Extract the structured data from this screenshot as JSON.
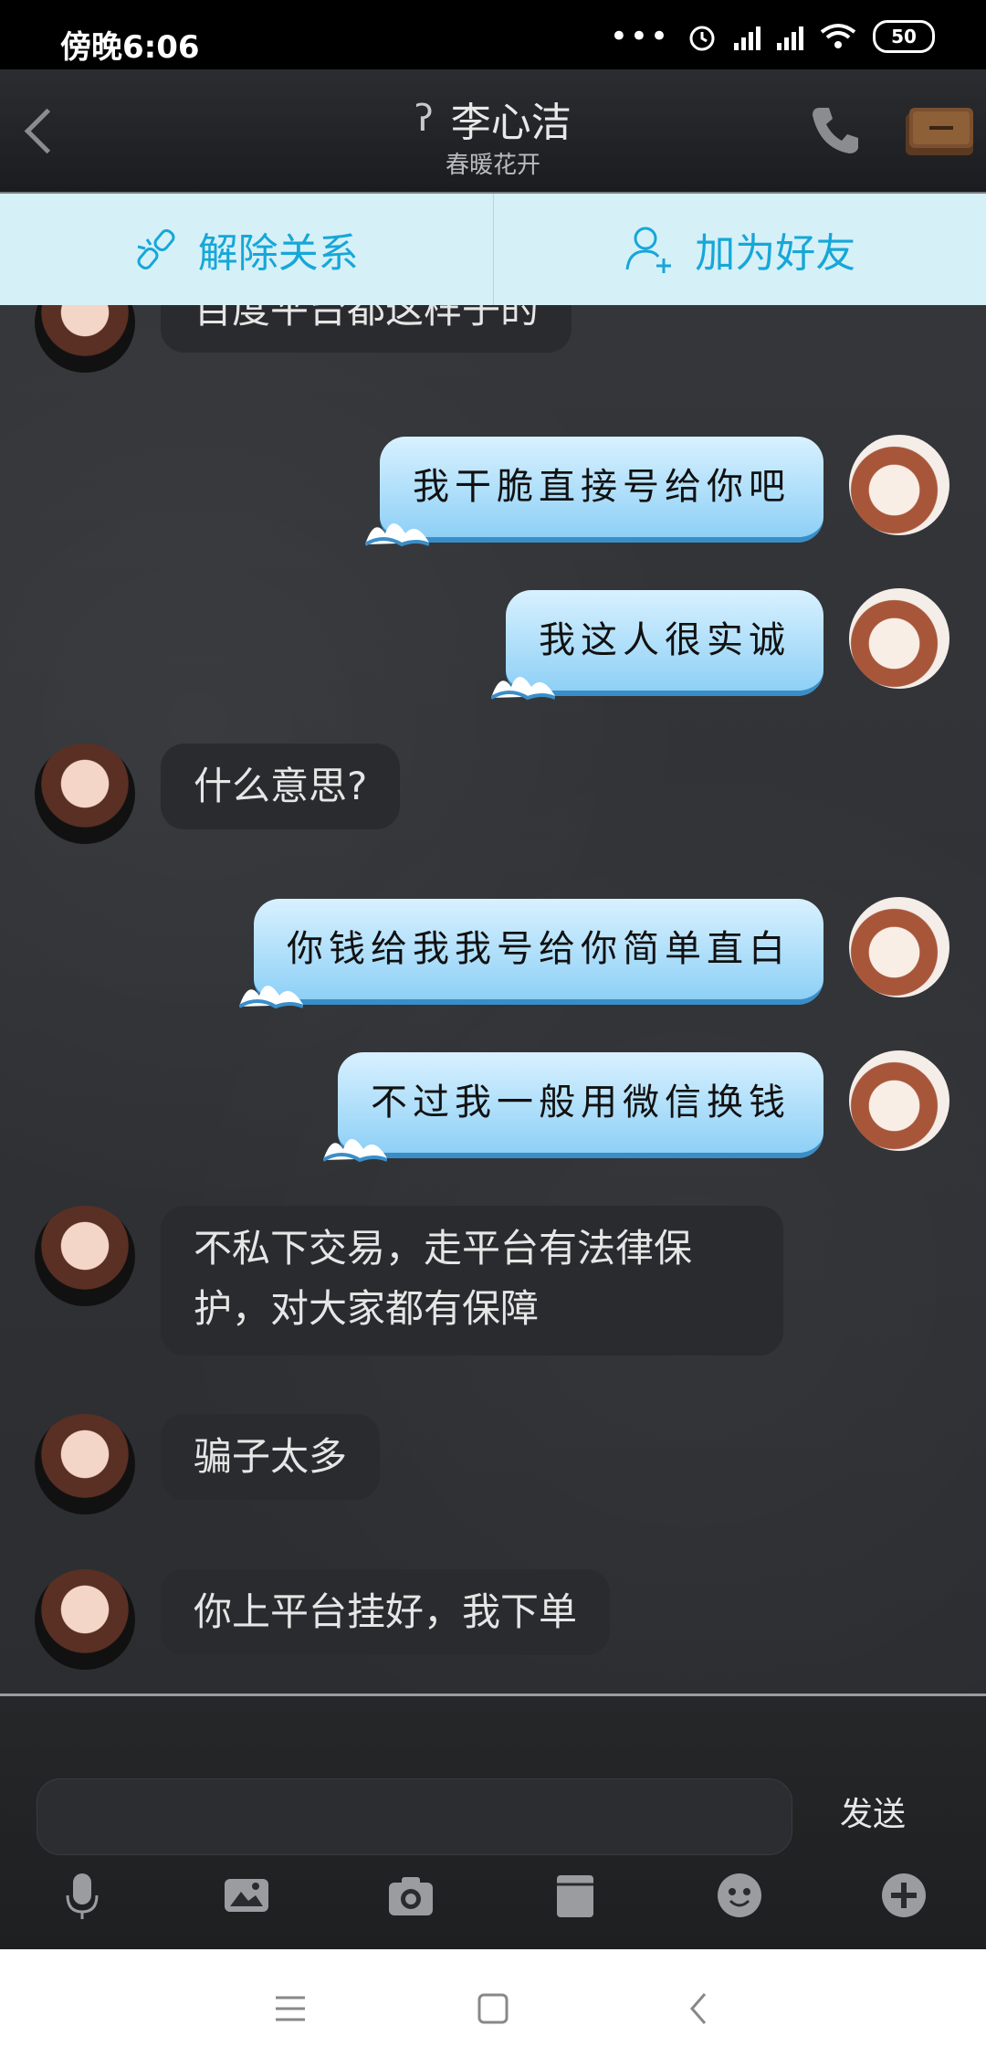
{
  "status": {
    "time": "傍晚6:06",
    "battery": "50"
  },
  "header": {
    "name": "李心洁",
    "subtitle": "春暖花开"
  },
  "actions": {
    "unbind": "解除关系",
    "add_friend": "加为好友"
  },
  "messages": [
    {
      "side": "left",
      "text": "百度平台都这样子的"
    },
    {
      "side": "right",
      "text": "我干脆直接号给你吧"
    },
    {
      "side": "right",
      "text": "我这人很实诚"
    },
    {
      "side": "left",
      "text": "什么意思?"
    },
    {
      "side": "right",
      "text": "你钱给我我号给你简单直白"
    },
    {
      "side": "right",
      "text": "不过我一般用微信换钱"
    },
    {
      "side": "left",
      "text": "不私下交易，走平台有法律保护，对大家都有保障"
    },
    {
      "side": "left",
      "text": "骗子太多"
    },
    {
      "side": "left",
      "text": "你上平台挂好，我下单"
    }
  ],
  "input": {
    "placeholder": "",
    "send_label": "发送"
  },
  "toolbar": [
    "mic-icon",
    "sticker-icon",
    "camera-icon",
    "file-icon",
    "emoji-icon",
    "plus-icon"
  ],
  "colors": {
    "accent": "#16a7d8",
    "bubble_right": "#9fd8f8",
    "bubble_left": "#2a2b2e"
  }
}
